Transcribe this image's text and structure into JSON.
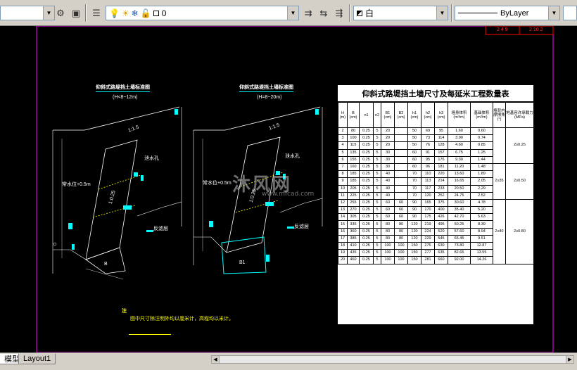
{
  "toolbar": {
    "layer_name": "0",
    "color_value": "白",
    "linetype_value": "ByLayer"
  },
  "drawing": {
    "left_title": "仰斜式路堤挡土墙标准图",
    "left_subtitle": "(H<8~12m)",
    "right_title": "仰斜式路堤挡土墙标准图",
    "right_subtitle": "(H=8~20m)",
    "labels": {
      "slope1": "1:1.5",
      "slope2": "1:1.5",
      "drain": "泄水孔",
      "gravel": "反滤层",
      "water": "常水位+0.5m",
      "ratio": "1:0.25",
      "base": "1:0.2",
      "width_left": "B",
      "width_right": "B1"
    },
    "title_block_left": "2 4 9",
    "title_block_right": "2 10 2",
    "note_title": "注",
    "note_text": "图中尺寸除注明外均以厘米计，高程均以米计。"
  },
  "table": {
    "title": "仰斜式路堤挡土墙尺寸及每延米工程数量表",
    "headers": [
      "H\n(m)",
      "B\n(cm)",
      "n1",
      "n2",
      "B1\n(cm)",
      "B2\n(cm)",
      "h1\n(cm)",
      "h2\n(cm)",
      "h3\n(cm)",
      "墙身体积\n(m³/m)",
      "基础体积\n(m³/m)",
      "墙背内摩擦角(°)",
      "地基容许承载力(MPa)"
    ],
    "rows": [
      [
        "2",
        "80",
        "0.25",
        "5",
        "20",
        "",
        "50",
        "69",
        "95",
        "1.60",
        "0.60"
      ],
      [
        "3",
        "100",
        "0.25",
        "5",
        "20",
        "",
        "50",
        "73",
        "114",
        "3.00",
        "0.74"
      ],
      [
        "4",
        "115",
        "0.25",
        "5",
        "20",
        "",
        "50",
        "76",
        "128",
        "4.60",
        "0.85"
      ],
      [
        "5",
        "135",
        "0.25",
        "5",
        "30",
        "",
        "60",
        "91",
        "157",
        "6.75",
        "1.25"
      ],
      [
        "6",
        "155",
        "0.25",
        "5",
        "30",
        "",
        "60",
        "95",
        "176",
        "9.30",
        "1.44"
      ],
      [
        "7",
        "160",
        "0.25",
        "5",
        "30",
        "",
        "60",
        "96",
        "181",
        "11.20",
        "1.48"
      ],
      [
        "8",
        "185",
        "0.25",
        "5",
        "40",
        "",
        "70",
        "110",
        "220",
        "13.60",
        "1.89"
      ],
      [
        "9",
        "185",
        "0.25",
        "5",
        "40",
        "",
        "70",
        "113",
        "214",
        "16.65",
        "2.05"
      ],
      [
        "10",
        "205",
        "0.25",
        "5",
        "40",
        "",
        "70",
        "117",
        "233",
        "20.50",
        "2.29"
      ],
      [
        "11",
        "225",
        "0.25",
        "5",
        "40",
        "",
        "70",
        "120",
        "252",
        "24.75",
        "2.52"
      ],
      [
        "12",
        "255",
        "0.25",
        "5",
        "60",
        "60",
        "90",
        "165",
        "375",
        "30.60",
        "4.78"
      ],
      [
        "13",
        "270",
        "0.25",
        "5",
        "60",
        "60",
        "90",
        "170",
        "400",
        "35.40",
        "5.20"
      ],
      [
        "14",
        "305",
        "0.25",
        "5",
        "60",
        "60",
        "90",
        "175",
        "426",
        "42.70",
        "5.63"
      ],
      [
        "15",
        "335",
        "0.25",
        "5",
        "80",
        "80",
        "120",
        "219",
        "495",
        "50.25",
        "8.39"
      ],
      [
        "16",
        "360",
        "0.25",
        "5",
        "80",
        "80",
        "120",
        "224",
        "520",
        "57.60",
        "8.94"
      ],
      [
        "17",
        "385",
        "0.25",
        "5",
        "80",
        "80",
        "120",
        "229",
        "545",
        "65.45",
        "9.51"
      ],
      [
        "18",
        "410",
        "0.25",
        "5",
        "100",
        "100",
        "150",
        "275",
        "630",
        "73.80",
        "12.87"
      ],
      [
        "19",
        "435",
        "0.25",
        "5",
        "100",
        "100",
        "150",
        "277",
        "635",
        "82.65",
        "13.55"
      ],
      [
        "20",
        "460",
        "0.25",
        "5",
        "100",
        "100",
        "150",
        "281",
        "660",
        "92.00",
        "14.26"
      ]
    ],
    "friction_groups": [
      {
        "value": "",
        "rows": 10
      },
      {
        "value": "2≥35",
        "rows": 0
      },
      {
        "value": "2≥40",
        "rows": 9
      }
    ],
    "bearing_groups": [
      {
        "value": "2≥0.25",
        "rows": 5
      },
      {
        "value": "2≥0.50",
        "rows": 5
      },
      {
        "value": "2≥0.80",
        "rows": 9
      }
    ]
  },
  "watermark": {
    "text": "沐风网",
    "sub": "www.mfcad.com"
  },
  "tabs": {
    "model": "模型",
    "layout1": "Layout1"
  }
}
